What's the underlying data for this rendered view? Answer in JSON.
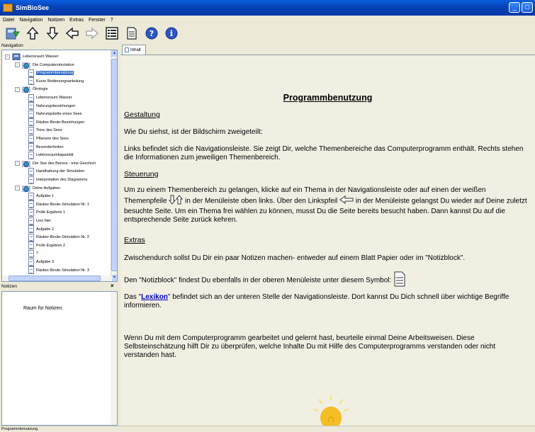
{
  "window": {
    "title": "SimBioSee"
  },
  "menu": [
    "Datei",
    "Navigation",
    "Notizen",
    "Extras",
    "Fenster",
    "?"
  ],
  "toolbar": {
    "icons": [
      "export-icon",
      "up-arrow-icon",
      "down-arrow-icon",
      "back-arrow-icon",
      "forward-arrow-icon",
      "list-icon",
      "notepad-icon",
      "help-icon",
      "info-icon"
    ]
  },
  "nav": {
    "header": "Navigation",
    "items": [
      {
        "label": "Lebensraum Wasser"
      },
      {
        "label": "Die Computersimulation"
      },
      {
        "label": "Programmbenutzung"
      },
      {
        "label": "Kurze Bedienungsanleitung"
      },
      {
        "label": "Ökologie"
      },
      {
        "label": "Lebensraum Wasser"
      },
      {
        "label": "Nahrungsbeziehungen"
      },
      {
        "label": "Nahrungskette eines Sees"
      },
      {
        "label": "Räuber-Beute-Beziehungen"
      },
      {
        "label": "Tiere des Sees"
      },
      {
        "label": "Pflanzen des Sees"
      },
      {
        "label": "Besonderheiten"
      },
      {
        "label": "Lebensraumkapazität"
      },
      {
        "label": "Der See des Barons - eine Geschich"
      },
      {
        "label": "Handhabung der Simulation"
      },
      {
        "label": "Interpretation des Diagramms"
      },
      {
        "label": "Deine Aufgaben"
      },
      {
        "label": "Aufgabe 1"
      },
      {
        "label": "Räuber-Beute-Simulation Nr. 1"
      },
      {
        "label": "Prüfe Ergebnis 1"
      },
      {
        "label": "Lies hier"
      },
      {
        "label": "Aufgabe 2"
      },
      {
        "label": "Räuber-Beute-Simulation Nr. 2"
      },
      {
        "label": "Prüfe Ergebnis 2"
      },
      {
        "label": "?"
      },
      {
        "label": "Aufgabe 3"
      },
      {
        "label": "Räuber-Beute-Simulation Nr. 3"
      }
    ]
  },
  "notes": {
    "header": "Notizen",
    "text": "Raum für Notizen."
  },
  "tab": {
    "label": "Inhalt"
  },
  "content": {
    "heading": "Programmbenutzung",
    "s1_title": "Gestaltung",
    "p1": "Wie Du siehst, ist der Bildschirm zweigeteilt:",
    "p2": "Links befindet sich die Navigationsleiste. Sie zeigt Dir, welche Themenbereiche das Computerprogramm enthält. Rechts stehen die Informationen zum jeweiligen Themenbereich.",
    "s2_title": "Steuerung",
    "p3a": "Um zu einem Themenbereich zu gelangen, klicke auf ein Thema in der Navigationsleiste oder auf einen der weißen Themenpfeile",
    "p3b": "in der Menüleiste oben links. Über den Linkspfeil",
    "p3c": "in der Menüleiste gelangst Du wieder auf Deine zuletzt besuchte Seite. Um ein Thema frei wählen zu können, musst Du die Seite bereits besucht haben. Dann kannst Du auf die entsprechende Seite zurück kehren.",
    "s3_title": "Extras",
    "p4": "Zwischendurch sollst Du Dir ein paar Notizen machen- entweder auf einem Blatt Papier oder im \"Notizblock\".",
    "p5": "Den \"Notizblock\" findest Du ebenfalls in der oberen Menüleiste unter diesem Symbol:",
    "p6a": "Das \"",
    "p6link": "Lexikon",
    "p6b": "\" befindet sich an der unteren Stelle der Navigationsleiste. Dort kannst Du Dich schnell über wichtige Begriffe informieren.",
    "p7": "Wenn Du mit dem Computerprogramm gearbeitet und gelernt hast, beurteile einmal Deine Arbeitsweisen. Diese Selbsteinschätzung hilft Dir zu überprüfen, welche Inhalte Du mit Hilfe des Computerprogramms verstanden oder nicht verstanden hast."
  },
  "status": {
    "text": "Programmbenutzung"
  }
}
